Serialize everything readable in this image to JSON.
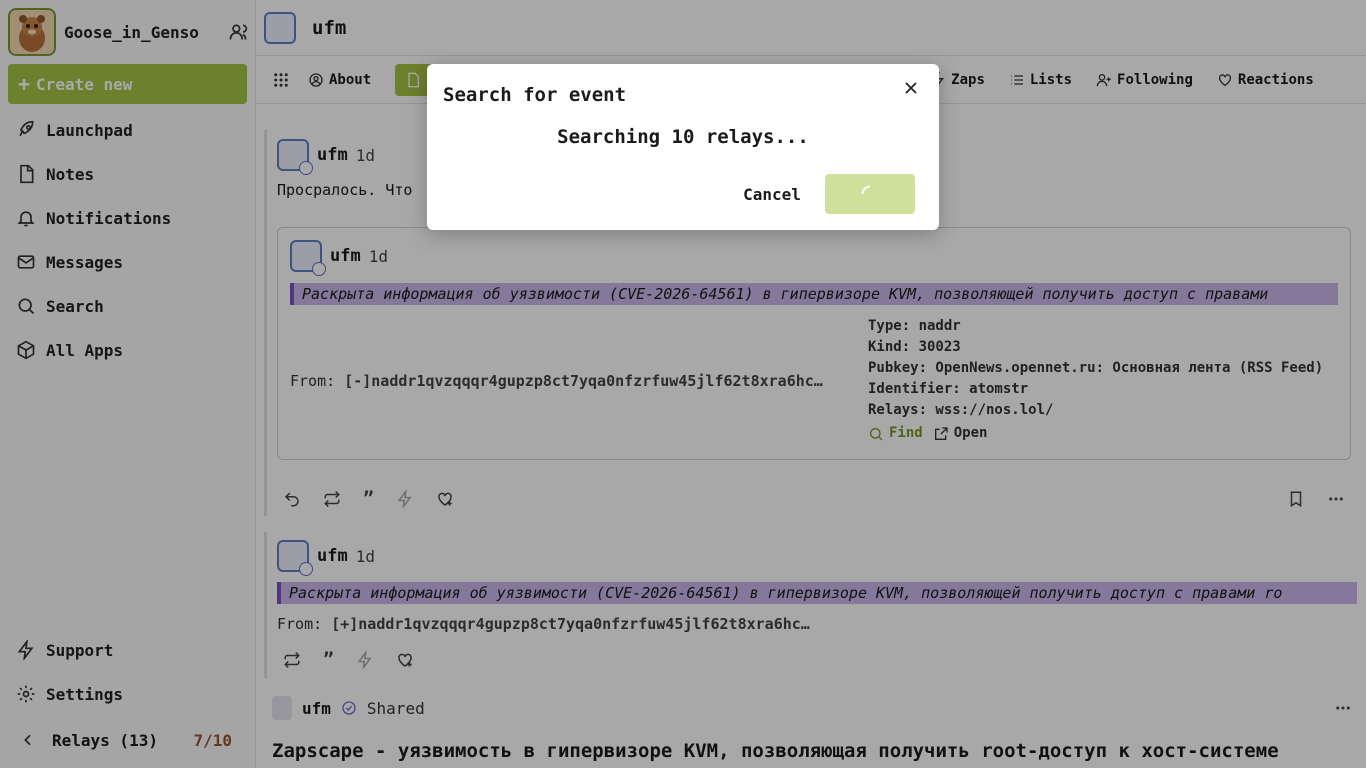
{
  "user": {
    "name": "Goose_in_Genso"
  },
  "sidebar": {
    "create_label": "Create new",
    "items": [
      {
        "label": "Launchpad",
        "icon": "rocket-icon"
      },
      {
        "label": "Notes",
        "icon": "file-icon"
      },
      {
        "label": "Notifications",
        "icon": "bell-icon"
      },
      {
        "label": "Messages",
        "icon": "mail-icon"
      },
      {
        "label": "Search",
        "icon": "search-icon"
      },
      {
        "label": "All Apps",
        "icon": "package-icon"
      }
    ],
    "bottom_items": [
      {
        "label": "Support",
        "icon": "bolt-icon"
      },
      {
        "label": "Settings",
        "icon": "gear-icon"
      }
    ],
    "relays_label": "Relays (13)",
    "relays_count": "7/10"
  },
  "header": {
    "title": "ufm"
  },
  "tabs": [
    {
      "label": "About",
      "icon": "user-circle-icon"
    },
    {
      "label": "",
      "icon": "file-icon",
      "active": true
    },
    {
      "label": "Zaps",
      "icon": "bolt-icon"
    },
    {
      "label": "Lists",
      "icon": "list-icon"
    },
    {
      "label": "Following",
      "icon": "user-plus-icon"
    },
    {
      "label": "Reactions",
      "icon": "heart-icon"
    }
  ],
  "feed": {
    "note1": {
      "author": "ufm",
      "time": "1d",
      "text": "Просралось. Что",
      "quote": {
        "author": "ufm",
        "time": "1d",
        "highlight": "Раскрыта информация об уязвимости (CVE-2026-64561) в гипервизоре KVM, позволяющей получить доступ с правами",
        "from_label": "From:",
        "from_value": "[-]naddr1qvzqqqr4gupzp8ct7yqa0nfzrfuw45jlf62t8xra6hc…",
        "meta_type": "Type: naddr",
        "meta_kind": "Kind: 30023",
        "meta_pubkey": "Pubkey: OpenNews.opennet.ru: Основная лента (RSS Feed)",
        "meta_identifier": "Identifier: atomstr",
        "meta_relays": "Relays: wss://nos.lol/",
        "find_label": "Find",
        "open_label": "Open"
      }
    },
    "note2": {
      "author": "ufm",
      "time": "1d",
      "highlight": "Раскрыта информация об уязвимости (CVE-2026-64561) в гипервизоре KVM, позволяющей получить доступ с правами ro",
      "from_label": "From:",
      "from_value": "[+]naddr1qvzqqqr4gupzp8ct7yqa0nfzrfuw45jlf62t8xra6hc…"
    },
    "note3": {
      "author": "ufm",
      "shared_label": "Shared",
      "title": "Zapscape - уязвимость в гипервизоре KVM, позволяющая получить root-доступ к хост-системе"
    }
  },
  "modal": {
    "title": "Search for event",
    "message": "Searching 10 relays...",
    "cancel_label": "Cancel"
  }
}
